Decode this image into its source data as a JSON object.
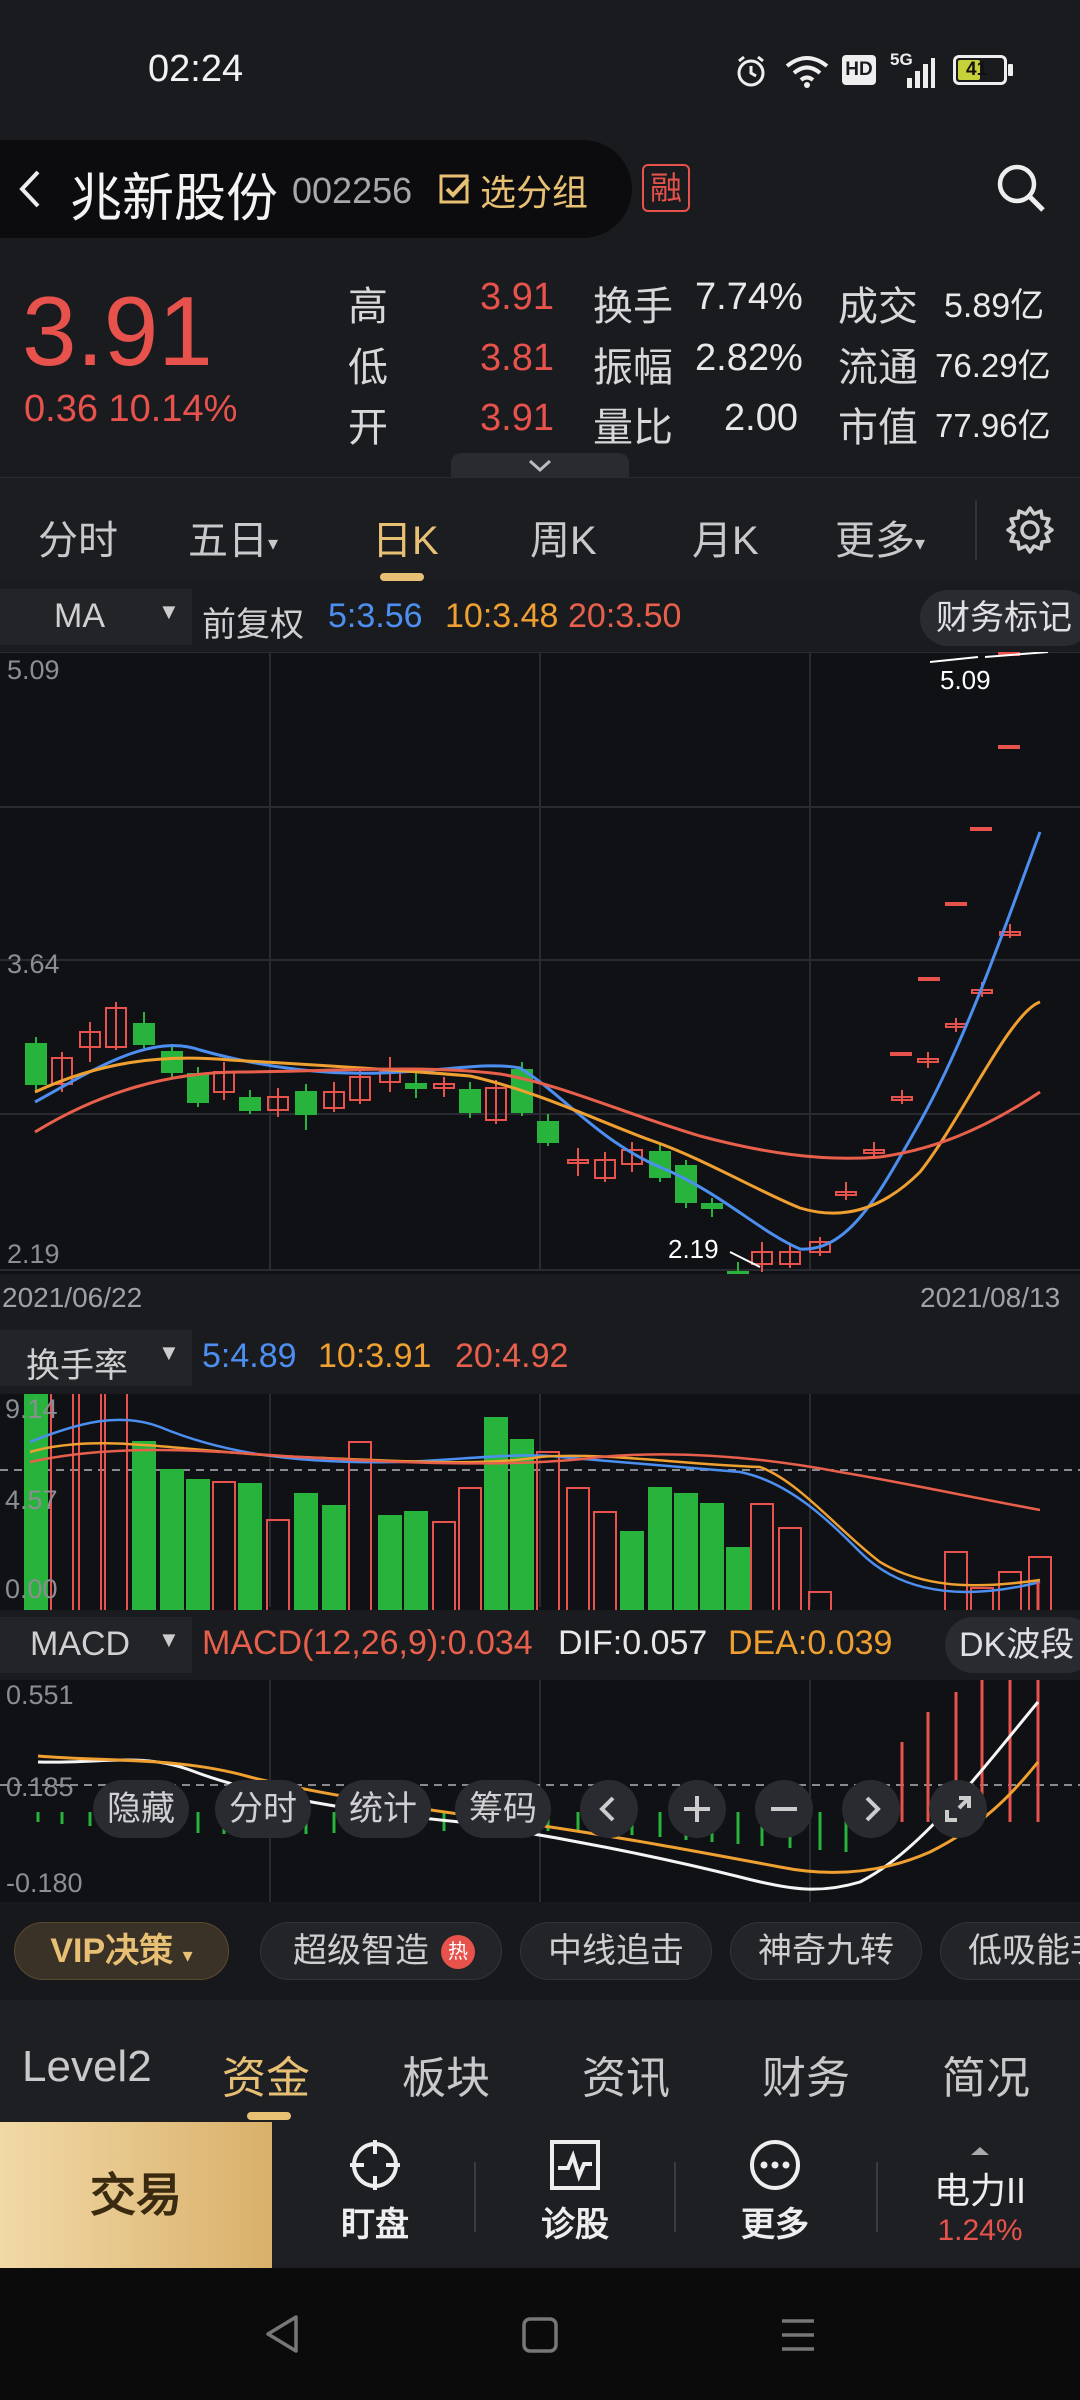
{
  "status_bar": {
    "time": "02:24",
    "battery": "41",
    "signal": "5G",
    "hd": "HD"
  },
  "header": {
    "back_icon": "chevron-left-icon",
    "stock_name": "兆新股份",
    "stock_code": "002256",
    "watchlist_label": "选分组",
    "margin_badge": "融",
    "search_icon": "search-icon"
  },
  "quote": {
    "price": "3.91",
    "change": "0.36",
    "change_pct": "10.14%",
    "stats": [
      {
        "label": "高",
        "value": "3.91"
      },
      {
        "label": "低",
        "value": "3.81"
      },
      {
        "label": "开",
        "value": "3.91"
      },
      {
        "label": "换手",
        "value": "7.74%"
      },
      {
        "label": "振幅",
        "value": "2.82%"
      },
      {
        "label": "量比",
        "value": "2.00"
      },
      {
        "label": "成交",
        "value": "5.89亿"
      },
      {
        "label": "流通",
        "value": "76.29亿"
      },
      {
        "label": "市值",
        "value": "77.96亿"
      }
    ]
  },
  "tabs": [
    "分时",
    "五日",
    "日K",
    "周K",
    "月K",
    "更多"
  ],
  "active_tab": "日K",
  "ma_bar": {
    "type_label": "MA",
    "adjust_label": "前复权",
    "ma5": "5:3.56",
    "ma10": "10:3.48",
    "ma20": "20:3.50",
    "finance_label": "财务标记"
  },
  "kline": {
    "y_high": "5.09",
    "y_mid": "3.64",
    "y_low": "2.19",
    "peak_label": "5.09",
    "trough_label": "2.19",
    "date_start": "2021/06/22",
    "date_end": "2021/08/13",
    "controls": [
      "隐藏",
      "分时",
      "统计",
      "筹码"
    ]
  },
  "turnover": {
    "label": "换手率",
    "ma5": "5:4.89",
    "ma10": "10:3.91",
    "ma20": "20:4.92",
    "y_top": "9.14",
    "y_mid": "4.57",
    "y_low": "0.00"
  },
  "macd": {
    "label": "MACD",
    "macd_value": "MACD(12,26,9):0.034",
    "dif": "DIF:0.057",
    "dea": "DEA:0.039",
    "dk_label": "DK波段",
    "y_top": "0.551",
    "y_mid": "0.185",
    "y_low": "-0.180"
  },
  "vip_bar": {
    "vip_label": "VIP决策",
    "chips": [
      "超级智造",
      "中线追击",
      "神奇九转",
      "低吸能手"
    ],
    "hot_badge": "热"
  },
  "bottom_tabs": [
    "Level2",
    "资金",
    "板块",
    "资讯",
    "财务",
    "简况"
  ],
  "active_bottom_tab": "资金",
  "action_bar": {
    "trade_label": "交易",
    "watch_label": "盯盘",
    "diagnose_label": "诊股",
    "more_label": "更多",
    "index_name": "电力II",
    "index_change": "1.24%"
  },
  "colors": {
    "up": "#e8524c",
    "down": "#28b33c",
    "accent": "#e8c074",
    "ma5": "#4c8ff0",
    "ma10": "#f0a030",
    "ma20": "#e8604c"
  }
}
